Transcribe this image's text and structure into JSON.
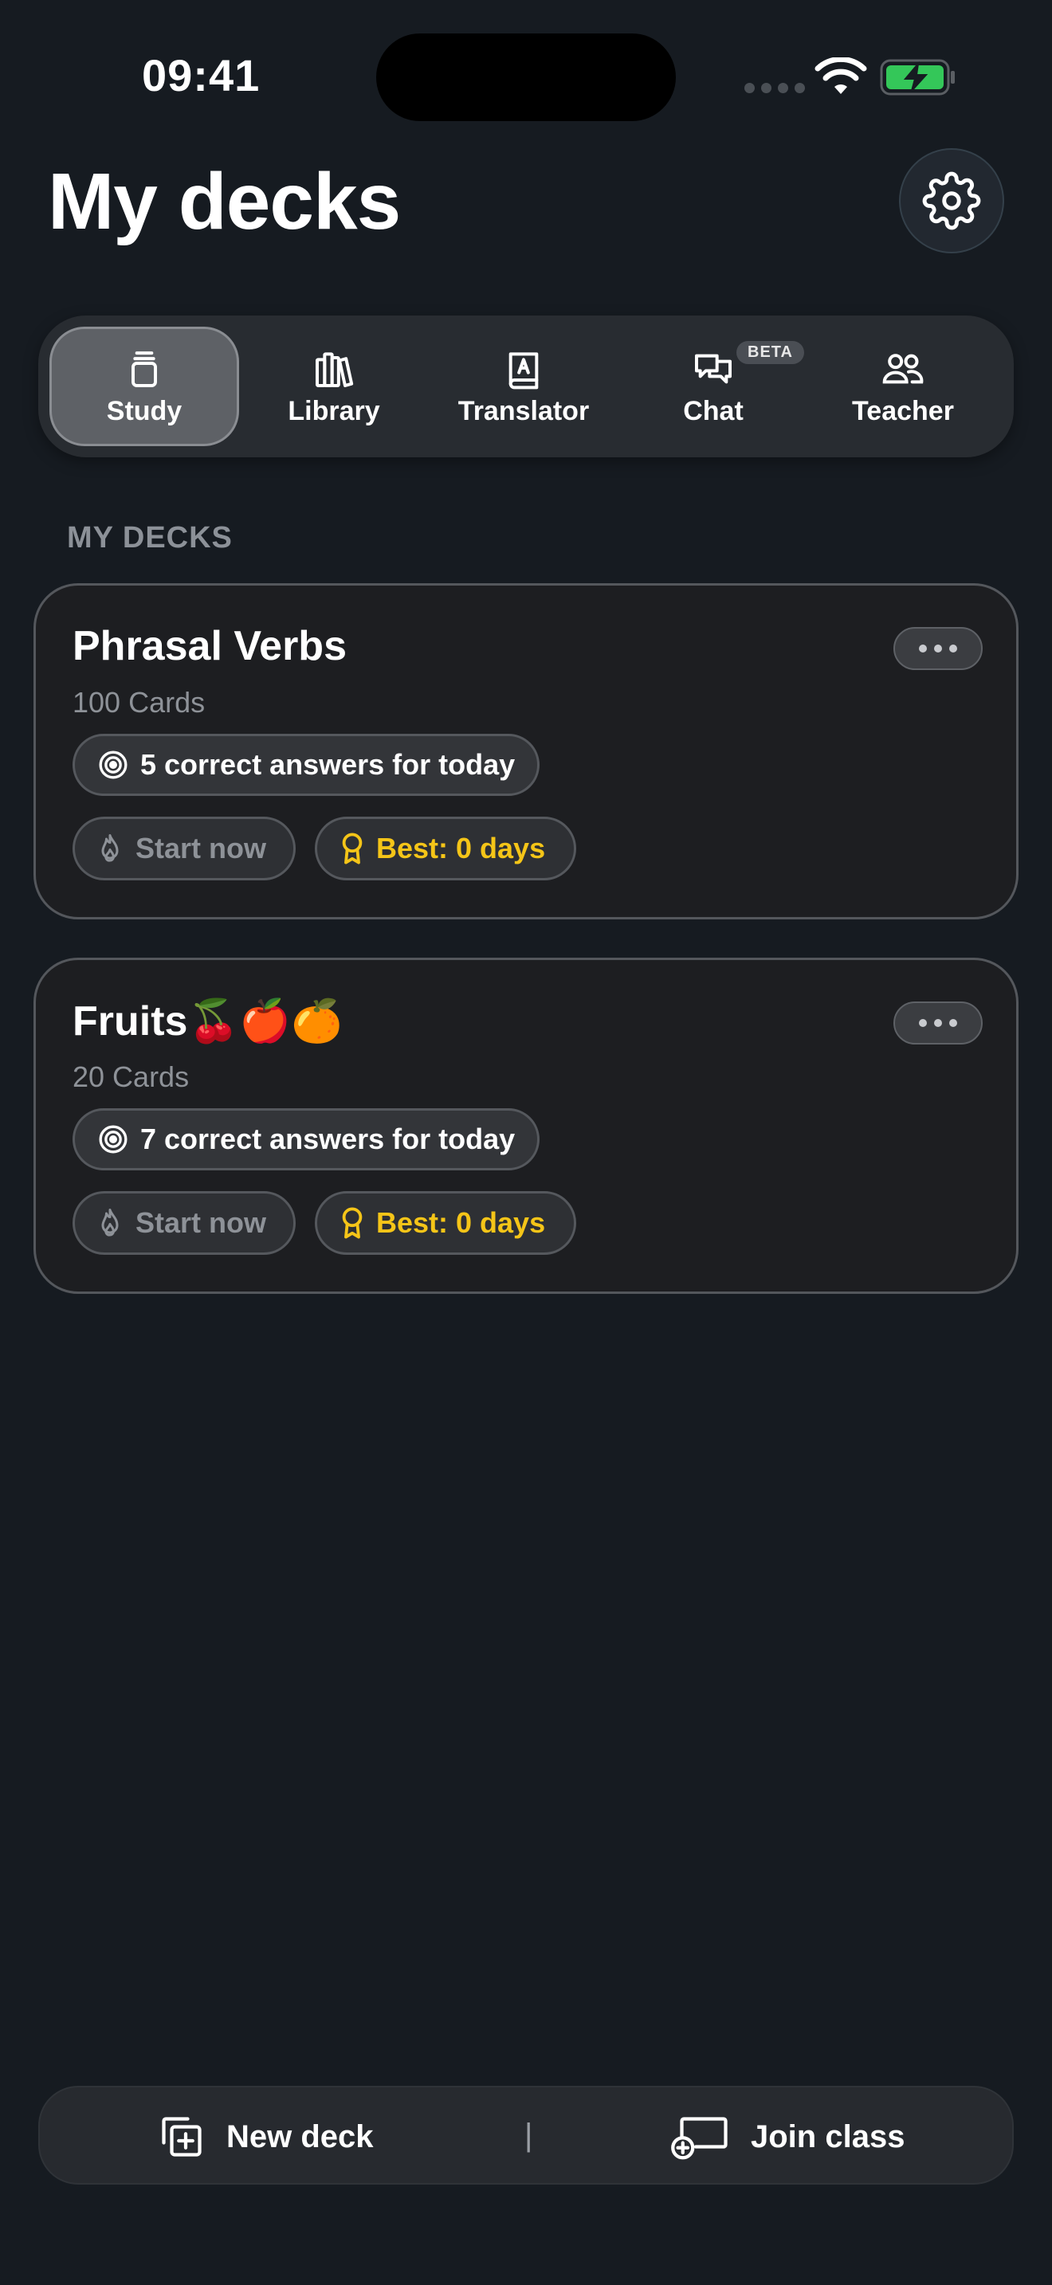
{
  "status_bar": {
    "time": "09:41"
  },
  "header": {
    "title": "My decks"
  },
  "tabs": [
    {
      "label": "Study",
      "icon": "study-stack-icon",
      "active": true
    },
    {
      "label": "Library",
      "icon": "library-books-icon",
      "active": false
    },
    {
      "label": "Translator",
      "icon": "translator-book-icon",
      "active": false
    },
    {
      "label": "Chat",
      "icon": "chat-bubbles-icon",
      "badge": "BETA",
      "active": false
    },
    {
      "label": "Teacher",
      "icon": "teacher-people-icon",
      "active": false
    }
  ],
  "section": {
    "title": "MY DECKS"
  },
  "decks": [
    {
      "title": "Phrasal Verbs",
      "count": "100 Cards",
      "goal": "5 correct answers for today",
      "start_label": "Start now",
      "best_label": "Best: 0 days"
    },
    {
      "title": "Fruits🍒🍎🍊",
      "count": "20 Cards",
      "goal": "7 correct answers for today",
      "start_label": "Start now",
      "best_label": "Best: 0 days"
    }
  ],
  "bottom_bar": {
    "new_deck_label": "New deck",
    "divider": "|",
    "join_class_label": "Join class"
  },
  "colors": {
    "background": "#161b21",
    "accent_gold": "#f5c518",
    "battery_green": "#34c759"
  }
}
